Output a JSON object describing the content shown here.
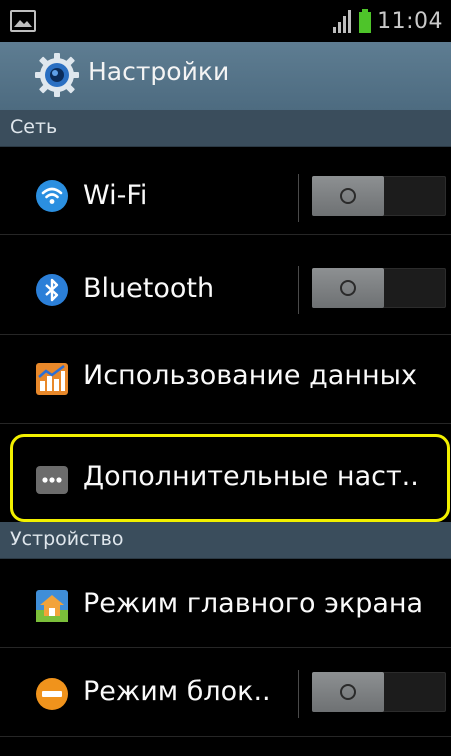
{
  "status_bar": {
    "time": "11:04",
    "battery_color": "#4ec42a",
    "icons": [
      "image-icon",
      "signal-icon",
      "battery-icon"
    ]
  },
  "header": {
    "title": "Настройки",
    "icon": "gear-icon"
  },
  "sections": {
    "network": {
      "title": "Сеть",
      "items": [
        {
          "label": "Wi-Fi",
          "icon": "wifi-icon",
          "toggle": "off"
        },
        {
          "label": "Bluetooth",
          "icon": "bluetooth-icon",
          "toggle": "off"
        },
        {
          "label": "Использование данных",
          "icon": "data-usage-icon"
        },
        {
          "label": "Дополнительные наст..",
          "icon": "more-icon",
          "highlighted": true
        }
      ]
    },
    "device": {
      "title": "Устройство",
      "items": [
        {
          "label": "Режим главного экрана",
          "icon": "home-icon"
        },
        {
          "label": "Режим блок..",
          "icon": "block-icon",
          "toggle": "off"
        }
      ]
    }
  },
  "colors": {
    "titlebar": "#5a788d",
    "section_header": "#3a4d5c",
    "highlight": "#f2f000"
  }
}
